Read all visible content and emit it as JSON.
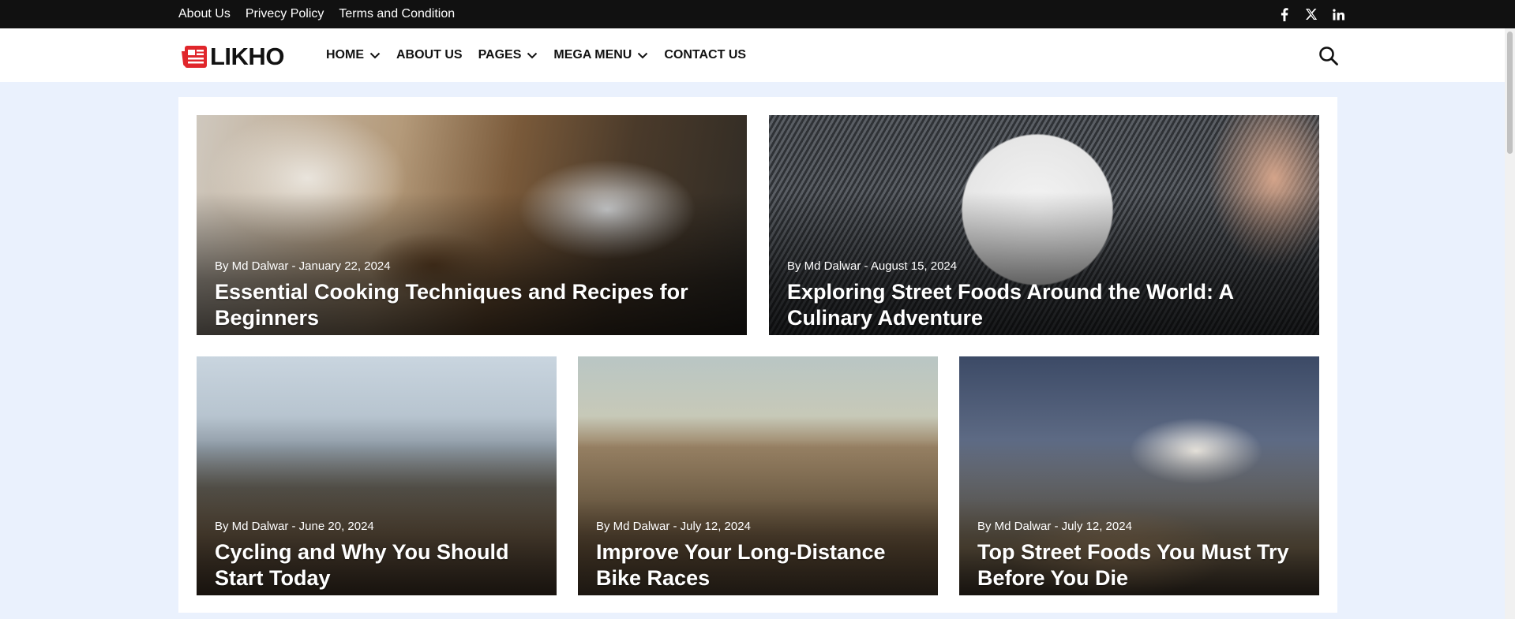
{
  "topbar": {
    "links": [
      "About Us",
      "Privecy Policy",
      "Terms and Condition"
    ],
    "social": [
      "facebook-icon",
      "x-twitter-icon",
      "linkedin-icon"
    ]
  },
  "header": {
    "logo_text": "LIKHO",
    "nav": [
      {
        "label": "HOME",
        "has_dropdown": true
      },
      {
        "label": "ABOUT US",
        "has_dropdown": false
      },
      {
        "label": "PAGES",
        "has_dropdown": true
      },
      {
        "label": "MEGA MENU",
        "has_dropdown": true
      },
      {
        "label": "CONTACT US",
        "has_dropdown": false
      }
    ],
    "search_icon": "search-icon"
  },
  "posts": [
    {
      "meta": "By Md Dalwar - January 22, 2024",
      "title": "Essential Cooking Techniques and Recipes for Beginners"
    },
    {
      "meta": "By Md Dalwar - August 15, 2024",
      "title": "Exploring Street Foods Around the World: A Culinary Adventure"
    },
    {
      "meta": "By Md Dalwar - June 20, 2024",
      "title": "Cycling and Why You Should Start Today"
    },
    {
      "meta": "By Md Dalwar - July 12, 2024",
      "title": "Improve Your Long-Distance Bike Races"
    },
    {
      "meta": "By Md Dalwar - July 12, 2024",
      "title": "Top Street Foods You Must Try Before You Die"
    }
  ],
  "colors": {
    "topbar_bg": "#111111",
    "page_bg": "#eaf1fd",
    "logo_accent": "#e0262b"
  }
}
